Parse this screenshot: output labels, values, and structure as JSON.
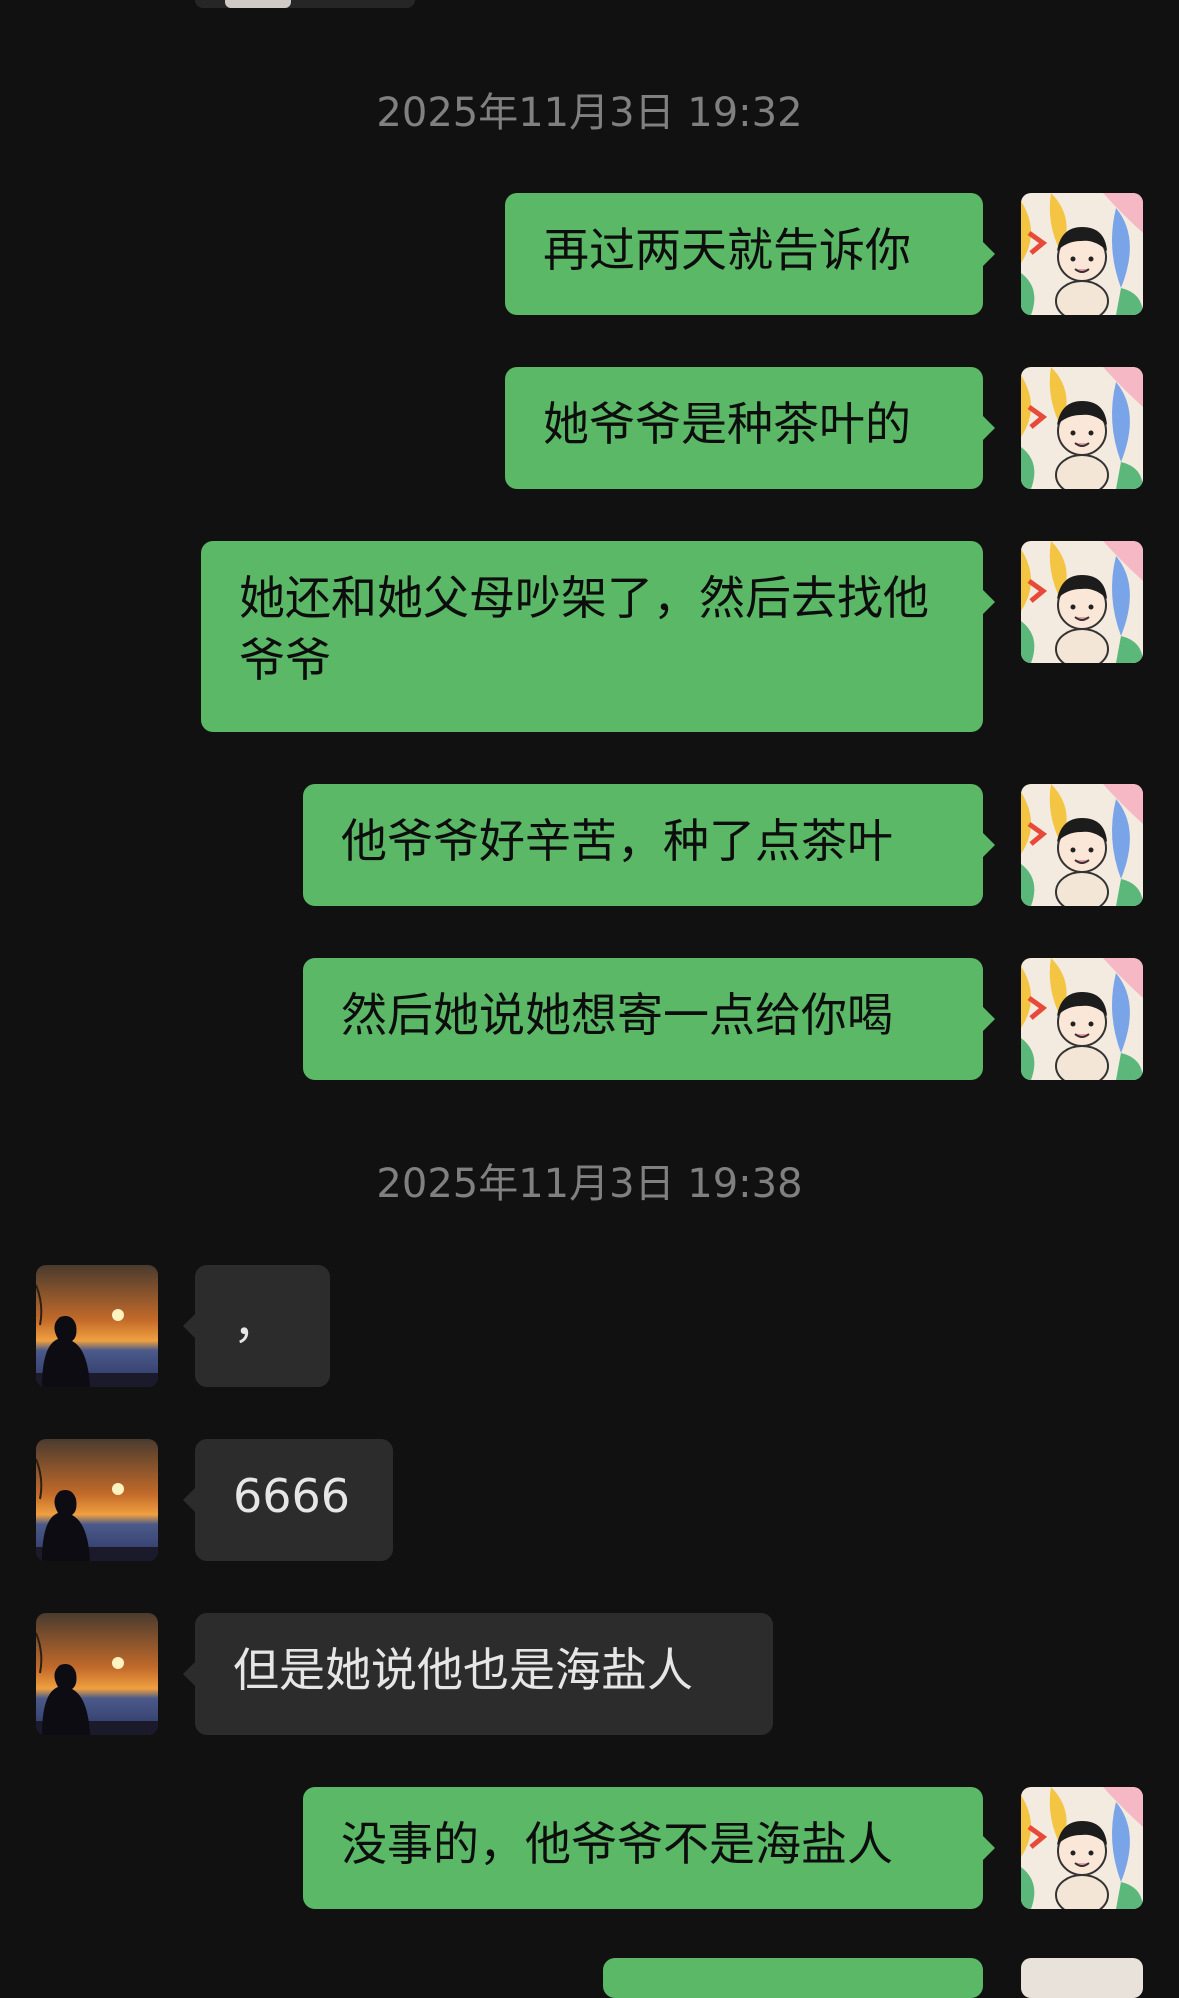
{
  "timestamps": [
    "2025年11月3日 19:32",
    "2025年11月3日 19:38"
  ],
  "messages": [
    {
      "sender": "me",
      "text": "再过两天就告诉你"
    },
    {
      "sender": "me",
      "text": "她爷爷是种茶叶的"
    },
    {
      "sender": "me",
      "text": "她还和她父母吵架了，然后去找他爷爷"
    },
    {
      "sender": "me",
      "text": "他爷爷好辛苦，种了点茶叶"
    },
    {
      "sender": "me",
      "text": "然后她说她想寄一点给你喝"
    },
    {
      "sender": "other",
      "text": "，"
    },
    {
      "sender": "other",
      "text": "6666"
    },
    {
      "sender": "other",
      "text": "但是她说他也是海盐人"
    },
    {
      "sender": "me",
      "text": "没事的，他爷爷不是海盐人"
    }
  ],
  "colors": {
    "background": "#111111",
    "bubble_me": "#5ab866",
    "bubble_other": "#2c2c2c",
    "timestamp": "#808080"
  },
  "icons": {
    "me_avatar": "cartoon-boy-avatar-icon",
    "other_avatar": "sunset-silhouette-avatar-icon"
  }
}
